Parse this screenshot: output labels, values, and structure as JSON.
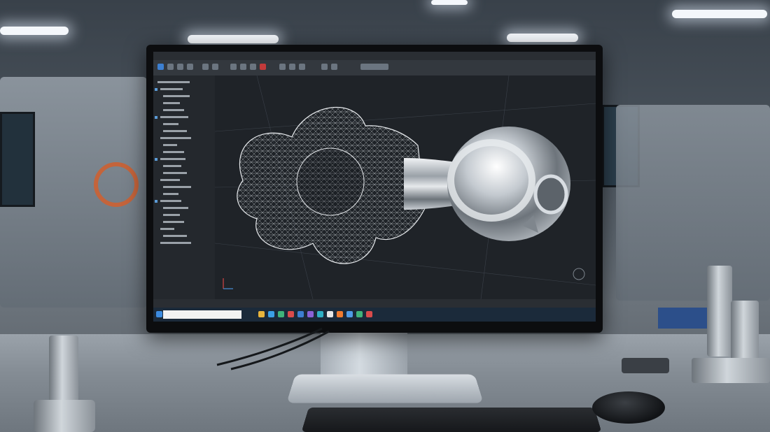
{
  "scene": {
    "description_colors": {
      "accent_metal": "#c8ced4",
      "screen_bg": "#1e2227",
      "wire": "#e6e9ec"
    }
  },
  "cad_app": {
    "menu_items": [
      "",
      "",
      "",
      "",
      "",
      "",
      "",
      "",
      "",
      "",
      "",
      ""
    ],
    "viewport_label": "",
    "search_placeholder": "",
    "time": ""
  }
}
